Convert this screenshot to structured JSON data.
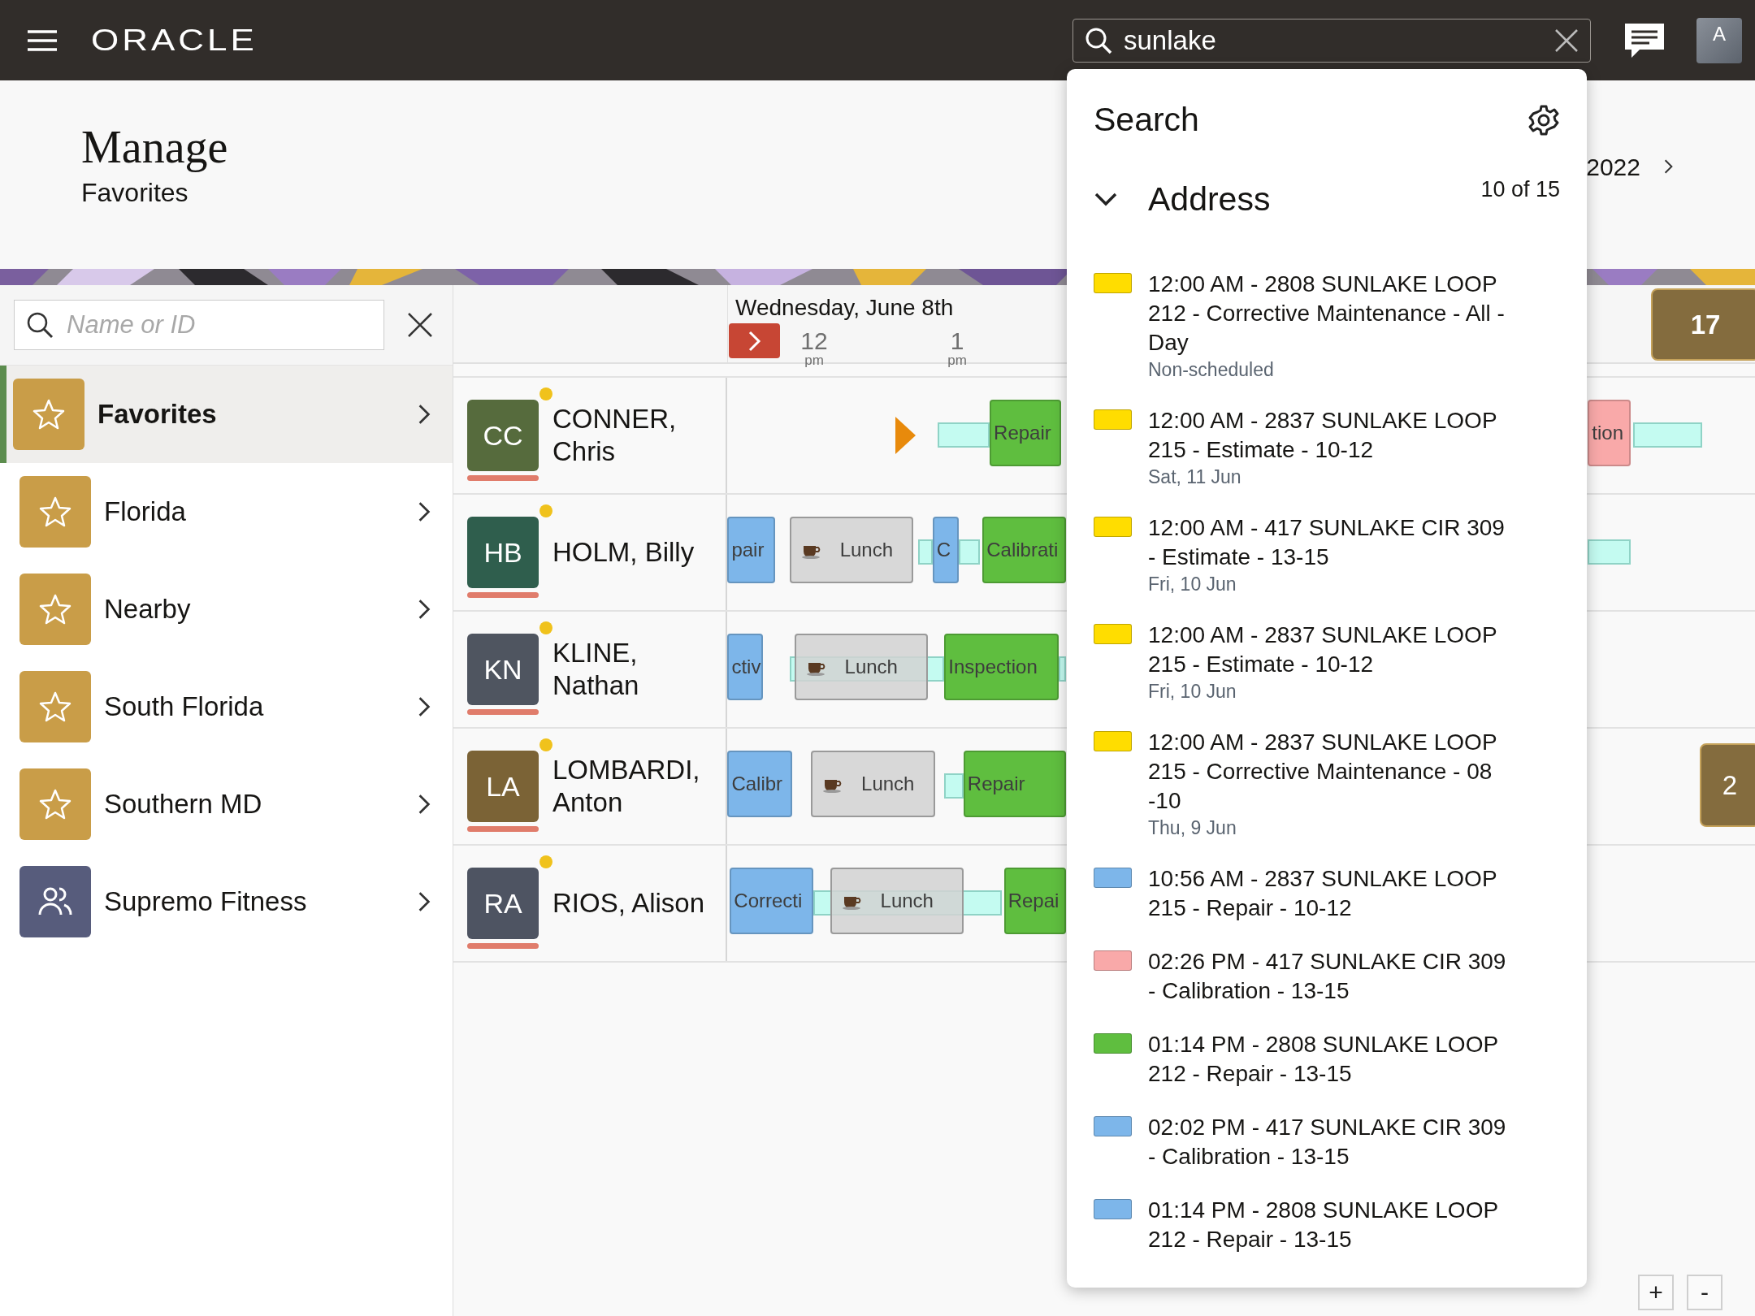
{
  "top_bar": {
    "logo": "ORACLE",
    "search": {
      "value": "sunlake"
    },
    "user_initial": "A"
  },
  "page_header": {
    "title": "Manage",
    "subtitle": "Favorites",
    "date_partial": "2022"
  },
  "sidebar": {
    "search": {
      "placeholder": "Name or ID"
    },
    "items": [
      {
        "label": "Favorites",
        "kind": "favorite",
        "selected": true
      },
      {
        "label": "Florida",
        "kind": "favorite",
        "selected": false
      },
      {
        "label": "Nearby",
        "kind": "favorite",
        "selected": false
      },
      {
        "label": "South Florida",
        "kind": "favorite",
        "selected": false
      },
      {
        "label": "Southern MD",
        "kind": "favorite",
        "selected": false
      },
      {
        "label": "Supremo Fitness",
        "kind": "group",
        "selected": false
      }
    ]
  },
  "schedule": {
    "date_title": "Wednesday, June 8th",
    "overflow_count": "17",
    "ticks": [
      {
        "hour": "12",
        "suffix": "pm"
      },
      {
        "hour": "1",
        "suffix": "pm"
      }
    ],
    "technicians": [
      {
        "initials": "CC",
        "name": "CONNER, Chris",
        "color": "#566b3d",
        "events": [
          {
            "kind": "marker"
          },
          {
            "kind": "travel"
          },
          {
            "kind": "job",
            "label": "Repair",
            "color": "#5fbe3f"
          },
          {
            "kind": "job",
            "label": "tion",
            "color": "#f9a9a9"
          },
          {
            "kind": "travel"
          }
        ]
      },
      {
        "initials": "HB",
        "name": "HOLM, Billy",
        "color": "#2f5e4d",
        "events": [
          {
            "kind": "job",
            "label": "pair",
            "color": "#7db6ea"
          },
          {
            "kind": "lunch",
            "label": "Lunch"
          },
          {
            "kind": "travel"
          },
          {
            "kind": "job",
            "label": "C",
            "color": "#7db6ea"
          },
          {
            "kind": "travel"
          },
          {
            "kind": "job",
            "label": "Calibrati",
            "color": "#5fbe3f"
          },
          {
            "kind": "travel"
          }
        ]
      },
      {
        "initials": "KN",
        "name": "KLINE, Nathan",
        "color": "#4f5560",
        "events": [
          {
            "kind": "job",
            "label": "ctiv",
            "color": "#7db6ea"
          },
          {
            "kind": "travel"
          },
          {
            "kind": "lunch",
            "label": "Lunch"
          },
          {
            "kind": "job",
            "label": "Inspection",
            "color": "#5fbe3f"
          },
          {
            "kind": "travel"
          }
        ]
      },
      {
        "initials": "LA",
        "name": "LOMBARDI, Anton",
        "color": "#7b6336",
        "overflow_count": "2",
        "events": [
          {
            "kind": "job",
            "label": "Calibr",
            "color": "#7db6ea"
          },
          {
            "kind": "lunch",
            "label": "Lunch"
          },
          {
            "kind": "travel"
          },
          {
            "kind": "job",
            "label": "Repair",
            "color": "#5fbe3f"
          }
        ]
      },
      {
        "initials": "RA",
        "name": "RIOS, Alison",
        "color": "#4e5462",
        "events": [
          {
            "kind": "job",
            "label": "Correcti",
            "color": "#7db6ea"
          },
          {
            "kind": "travel"
          },
          {
            "kind": "lunch",
            "label": "Lunch"
          },
          {
            "kind": "job",
            "label": "Repai",
            "color": "#5fbe3f"
          }
        ]
      }
    ]
  },
  "search_panel": {
    "title": "Search",
    "section": {
      "title": "Address",
      "expanded": true,
      "count": "10 of 15"
    },
    "results": [
      {
        "color": "#ffdd00",
        "text": "12:00 AM - 2808 SUNLAKE LOOP 212 - Corrective Maintenance - All -Day",
        "detail": "Non-scheduled"
      },
      {
        "color": "#ffdd00",
        "text": "12:00 AM - 2837 SUNLAKE LOOP 215 - Estimate - 10-12",
        "detail": "Sat, 11 Jun"
      },
      {
        "color": "#ffdd00",
        "text": "12:00 AM - 417 SUNLAKE CIR 309 - Estimate - 13-15",
        "detail": "Fri, 10 Jun"
      },
      {
        "color": "#ffdd00",
        "text": "12:00 AM - 2837 SUNLAKE LOOP 215 - Estimate - 10-12",
        "detail": "Fri, 10 Jun"
      },
      {
        "color": "#ffdd00",
        "text": "12:00 AM - 2837 SUNLAKE LOOP 215 - Corrective Maintenance - 08 -10",
        "detail": "Thu, 9 Jun"
      },
      {
        "color": "#7db6ea",
        "text": "10:56 AM - 2837 SUNLAKE LOOP 215 - Repair - 10-12"
      },
      {
        "color": "#f9a9a9",
        "text": "02:26 PM - 417 SUNLAKE CIR 309 - Calibration - 13-15"
      },
      {
        "color": "#5fbe3f",
        "text": "01:14 PM - 2808 SUNLAKE LOOP 212 - Repair - 13-15"
      },
      {
        "color": "#7db6ea",
        "text": "02:02 PM - 417 SUNLAKE CIR 309 - Calibration - 13-15"
      },
      {
        "color": "#7db6ea",
        "text": "01:14 PM - 2808 SUNLAKE LOOP 212 - Repair - 13-15"
      }
    ]
  },
  "zoom_controls": [
    "+",
    "-"
  ]
}
